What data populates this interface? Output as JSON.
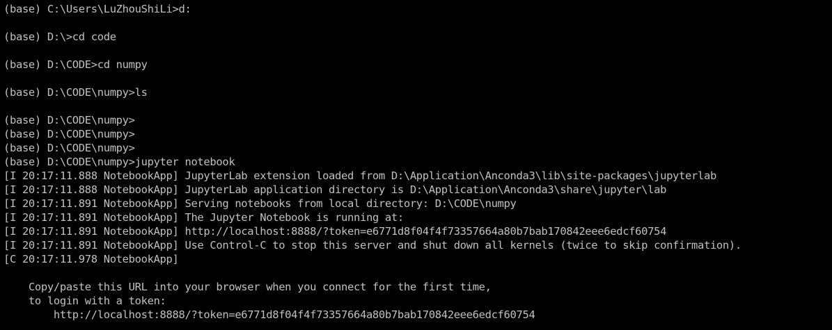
{
  "console": {
    "lines": [
      "(base) C:\\Users\\LuZhouShiLi>d:",
      "",
      "(base) D:\\>cd code",
      "",
      "(base) D:\\CODE>cd numpy",
      "",
      "(base) D:\\CODE\\numpy>ls",
      "",
      "(base) D:\\CODE\\numpy>",
      "(base) D:\\CODE\\numpy>",
      "(base) D:\\CODE\\numpy>",
      "(base) D:\\CODE\\numpy>jupyter notebook",
      "[I 20:17:11.888 NotebookApp] JupyterLab extension loaded from D:\\Application\\Anconda3\\lib\\site-packages\\jupyterlab",
      "[I 20:17:11.888 NotebookApp] JupyterLab application directory is D:\\Application\\Anconda3\\share\\jupyter\\lab",
      "[I 20:17:11.891 NotebookApp] Serving notebooks from local directory: D:\\CODE\\numpy",
      "[I 20:17:11.891 NotebookApp] The Jupyter Notebook is running at:",
      "[I 20:17:11.891 NotebookApp] http://localhost:8888/?token=e6771d8f04f4f73357664a80b7bab170842eee6edcf60754",
      "[I 20:17:11.891 NotebookApp] Use Control-C to stop this server and shut down all kernels (twice to skip confirmation).",
      "[C 20:17:11.978 NotebookApp]",
      "",
      "    Copy/paste this URL into your browser when you connect for the first time,",
      "    to login with a token:",
      "        http://localhost:8888/?token=e6771d8f04f4f73357664a80b7bab170842eee6edcf60754"
    ]
  },
  "colors": {
    "background": "#000000",
    "foreground": "#c0c0c0"
  }
}
